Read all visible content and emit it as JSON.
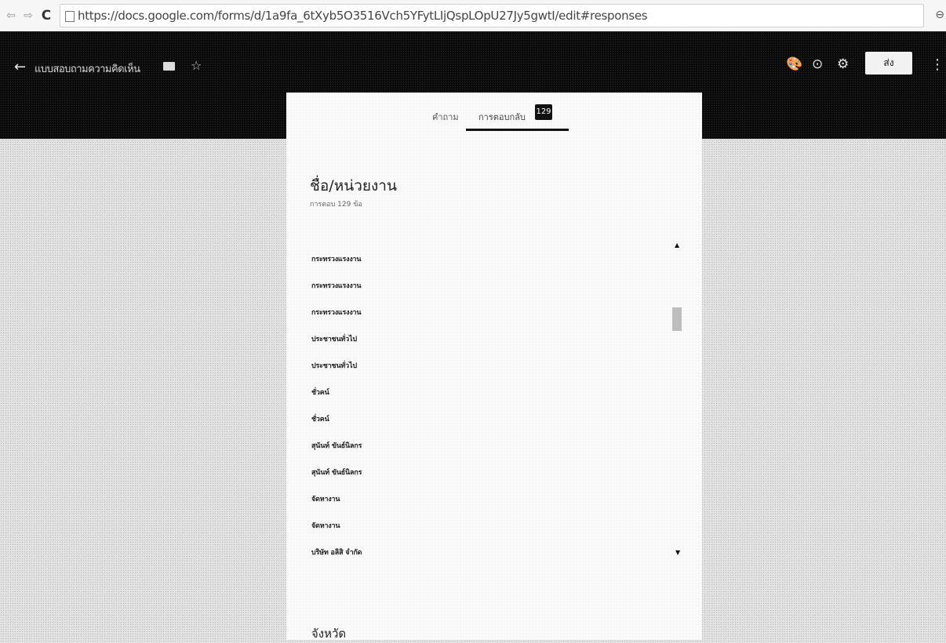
{
  "browser": {
    "back_icon": "⇦",
    "forward_icon": "⇨",
    "reload_icon": "C",
    "url": "https://docs.google.com/forms/d/1a9fa_6tXyb5O3516Vch5YFytLIjQspLOpU27Jy5gwtI/edit#responses",
    "right_icon": "⊖"
  },
  "header": {
    "back_icon": "←",
    "title": "แบบสอบถามความคิดเห็น",
    "star_icon": "☆",
    "palette_icon": "🎨",
    "preview_icon": "⊙",
    "settings_icon": "⚙",
    "send_label": "ส่ง",
    "more_icon": "⋮"
  },
  "tabs": {
    "questions_label": "คำถาม",
    "responses_label": "การตอบกลับ",
    "responses_count": "129"
  },
  "question": {
    "title": "ชื่อ/หน่วยงาน",
    "subtitle": "การตอบ 129 ข้อ",
    "responses": [
      "กระทรวงแรงงาน",
      "กระทรวงแรงงาน",
      "กระทรวงแรงงาน",
      "ประชาชนทั่วไป",
      "ประชาชนทั่วไป",
      "ชั่วคน์",
      "ชั่วคน์",
      "สุนันท์ ขันธ์นิลกร",
      "สุนันท์ ขันธ์นิลกร",
      "จัดหางาน",
      "จัดหางาน",
      "บริษัท อลิสิ จำกัด"
    ],
    "scroll_up_icon": "▲",
    "scroll_down_icon": "▼"
  },
  "question2": {
    "title": "จังหวัด"
  }
}
